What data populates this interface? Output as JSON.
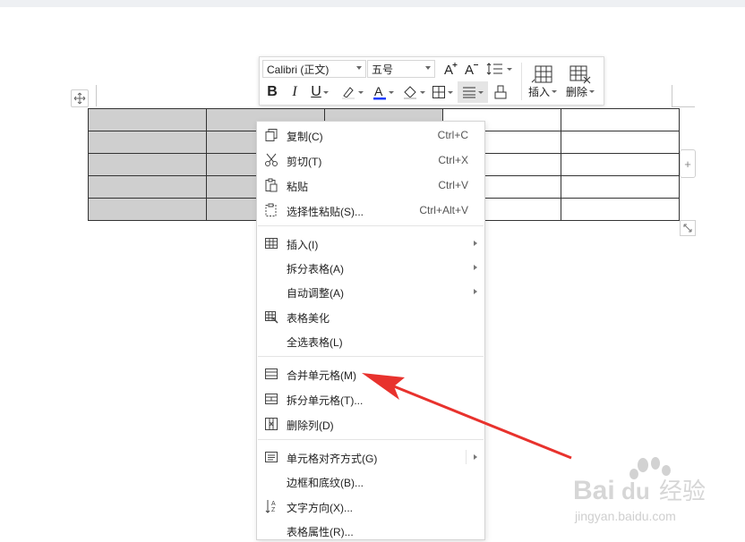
{
  "toolbar": {
    "font_name": "Calibri (正文)",
    "font_size": "五号",
    "insert_label": "插入",
    "delete_label": "删除"
  },
  "table": {
    "rows": 5,
    "cols": 5,
    "selected_cols": [
      0,
      1,
      2
    ]
  },
  "menu": {
    "copy": {
      "label": "复制(C)",
      "shortcut": "Ctrl+C"
    },
    "cut": {
      "label": "剪切(T)",
      "shortcut": "Ctrl+X"
    },
    "paste": {
      "label": "粘贴",
      "shortcut": "Ctrl+V"
    },
    "paste_special": {
      "label": "选择性粘贴(S)...",
      "shortcut": "Ctrl+Alt+V"
    },
    "insert": {
      "label": "插入(I)"
    },
    "split_table": {
      "label": "拆分表格(A)"
    },
    "auto_fit": {
      "label": "自动调整(A)"
    },
    "beautify": {
      "label": "表格美化"
    },
    "select_table": {
      "label": "全选表格(L)"
    },
    "merge_cells": {
      "label": "合并单元格(M)"
    },
    "split_cells": {
      "label": "拆分单元格(T)..."
    },
    "delete_col": {
      "label": "删除列(D)"
    },
    "cell_align": {
      "label": "单元格对齐方式(G)"
    },
    "borders": {
      "label": "边框和底纹(B)..."
    },
    "text_dir": {
      "label": "文字方向(X)..."
    },
    "table_props": {
      "label": "表格属性(R)..."
    }
  },
  "colors": {
    "selection": "#cfcfcf",
    "annotation_arrow": "#e8322d",
    "font_color_bar": "#1a3cff"
  },
  "watermark": {
    "brand": "Bai",
    "brand2": "du",
    "cn": "经验",
    "url": "jingyan.baidu.com"
  }
}
